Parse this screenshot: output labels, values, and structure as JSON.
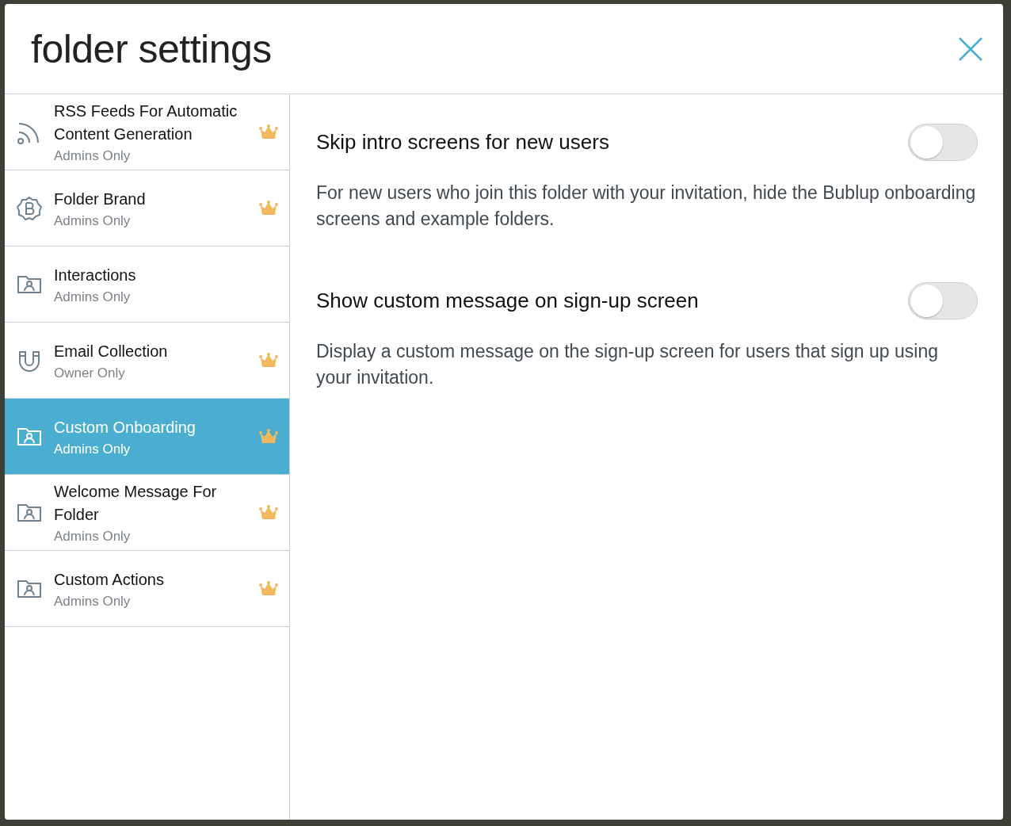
{
  "dialog": {
    "title": "folder settings"
  },
  "sidebar": {
    "items": [
      {
        "kind": "rss",
        "title": "RSS Feeds For Automatic Content Generation",
        "subtitle": "Admins Only",
        "premium": true,
        "selected": false
      },
      {
        "kind": "brand",
        "title": "Folder Brand",
        "subtitle": "Admins Only",
        "premium": true,
        "selected": false
      },
      {
        "kind": "folder",
        "title": "Interactions",
        "subtitle": "Admins Only",
        "premium": false,
        "selected": false
      },
      {
        "kind": "magnet",
        "title": "Email Collection",
        "subtitle": "Owner Only",
        "premium": true,
        "selected": false
      },
      {
        "kind": "folder",
        "title": "Custom Onboarding",
        "subtitle": "Admins Only",
        "premium": true,
        "selected": true
      },
      {
        "kind": "folder",
        "title": "Welcome Message For Folder",
        "subtitle": "Admins Only",
        "premium": true,
        "selected": false
      },
      {
        "kind": "folder",
        "title": "Custom Actions",
        "subtitle": "Admins Only",
        "premium": true,
        "selected": false
      }
    ]
  },
  "settings": [
    {
      "label": "Skip intro screens for new users",
      "on": false,
      "description": "For new users who join this folder with your invitation, hide the Bublup onboarding screens and example folders."
    },
    {
      "label": "Show custom message on sign-up screen",
      "on": false,
      "description": "Display a custom message on the sign-up screen for users that sign up using your invitation."
    }
  ]
}
